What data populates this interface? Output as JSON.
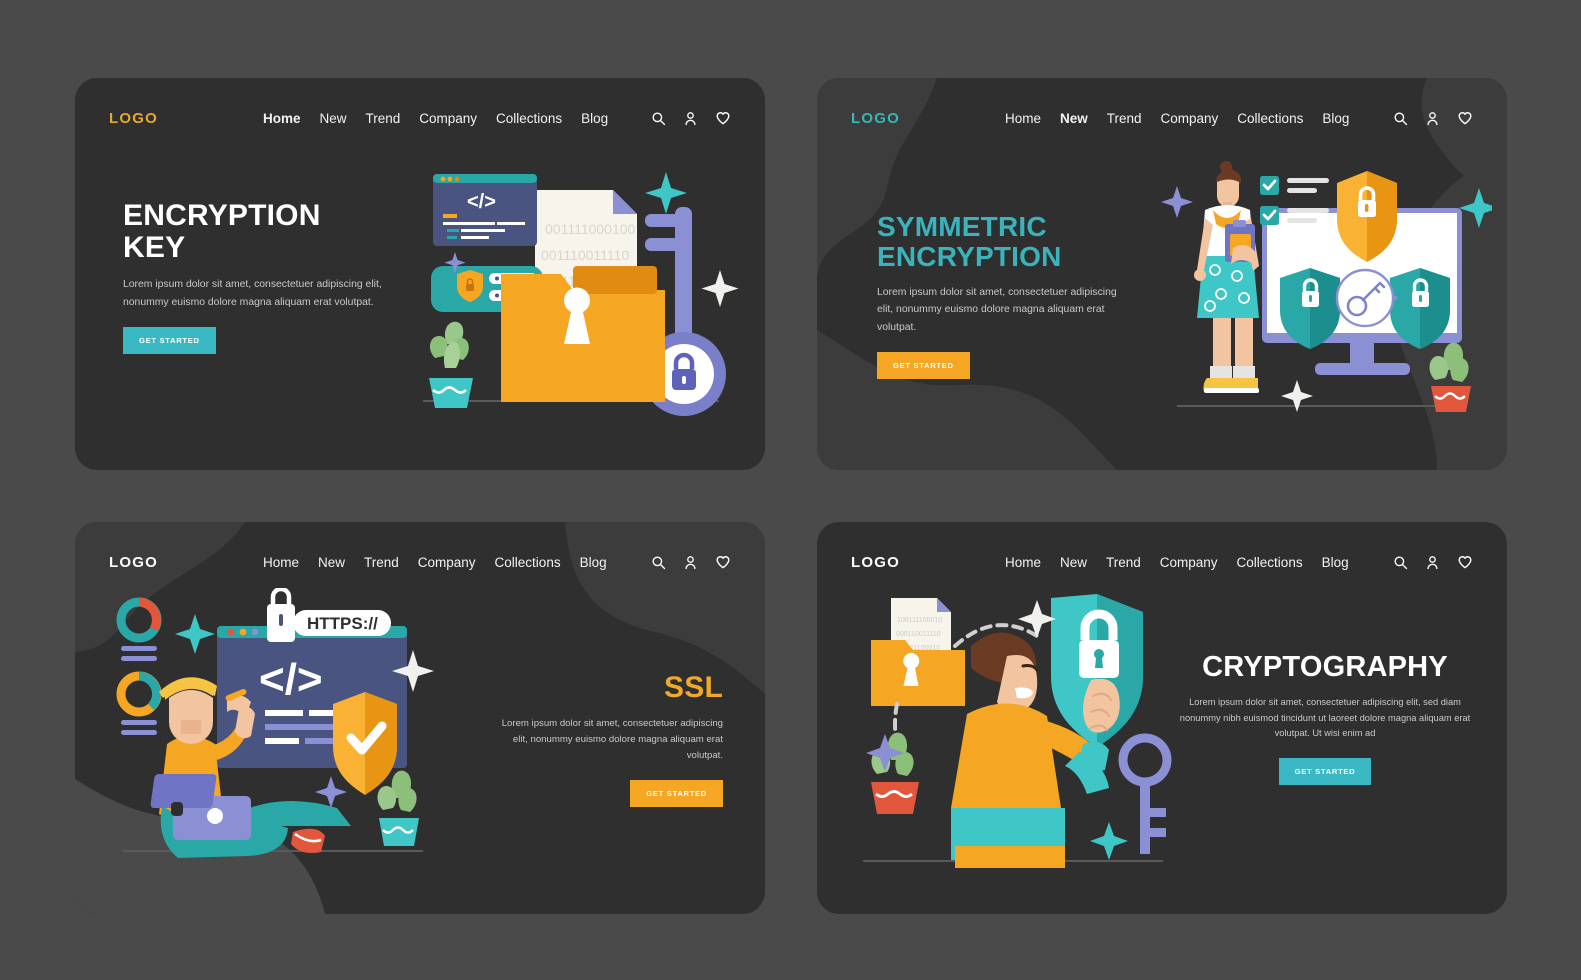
{
  "page": {
    "background_color": "#4a4a4a",
    "panel_color": "#2f2f2f",
    "blob_color": "#3c3c3c"
  },
  "nav_items": [
    "Home",
    "New",
    "Trend",
    "Company",
    "Collections",
    "Blog"
  ],
  "header_icons": [
    "search-icon",
    "user-icon",
    "heart-icon"
  ],
  "panels": [
    {
      "id": "encryption-key",
      "logo": "LOGO",
      "logo_color": "#e6a832",
      "active_nav": "Home",
      "title_line1": "ENCRYPTION",
      "title_line2": "KEY",
      "title_color": "#ffffff",
      "body": "Lorem ipsum dolor sit amet, consectetuer adipiscing elit, nonummy euismo dolore magna aliquam erat volutpat.",
      "cta": "GET STARTED",
      "cta_color": "#3ab9c4",
      "binary_lines": [
        "001111000100",
        "001110011110",
        "001111000100"
      ]
    },
    {
      "id": "symmetric-encryption",
      "logo": "LOGO",
      "logo_color": "#39b6b6",
      "active_nav": "New",
      "title_line1": "SYMMETRIC",
      "title_line2": "ENCRYPTION",
      "title_color": "#3ab3bd",
      "body": "Lorem ipsum dolor sit amet, consectetuer adipiscing elit, nonummy euismo dolore magna aliquam erat volutpat.",
      "cta": "GET STARTED",
      "cta_color": "#f5a623"
    },
    {
      "id": "ssl",
      "logo": "LOGO",
      "logo_color": "#ffffff",
      "active_nav": "",
      "title_line1": "SSL",
      "title_line2": "",
      "title_color": "#f0a92a",
      "body": "Lorem ipsum dolor sit amet, consectetuer adipiscing elit, nonummy euismo dolore magna aliquam erat volutpat.",
      "cta": "GET STARTED",
      "cta_color": "#f5a623",
      "url_badge": "HTTPS://",
      "code_glyph": "</>"
    },
    {
      "id": "cryptography",
      "logo": "LOGO",
      "logo_color": "#ffffff",
      "active_nav": "",
      "title_line1": "CRYPTOGRAPHY",
      "title_line2": "",
      "title_color": "#ffffff",
      "body": "Lorem ipsum dolor sit amet, consectetuer adipiscing elit, sed diam nonummy nibh euismod tincidunt ut laoreet dolore magna aliquam erat volutpat. Ut wisi enim ad",
      "cta": "GET STARTED",
      "cta_color": "#3ab9c4",
      "binary_lines": [
        "100111100010",
        "000110011110",
        "100111100010"
      ]
    }
  ],
  "illustration_colors": {
    "orange": "#f5a623",
    "orange_dark": "#e08c12",
    "teal": "#2aa7a7",
    "teal_light": "#3fc6c6",
    "periwinkle": "#8b8fd4",
    "periwinkle_dark": "#6f74c4",
    "navy": "#4a5480",
    "cream": "#f7f4ec",
    "white": "#ffffff",
    "green": "#8cc07a",
    "red": "#e2573c"
  }
}
